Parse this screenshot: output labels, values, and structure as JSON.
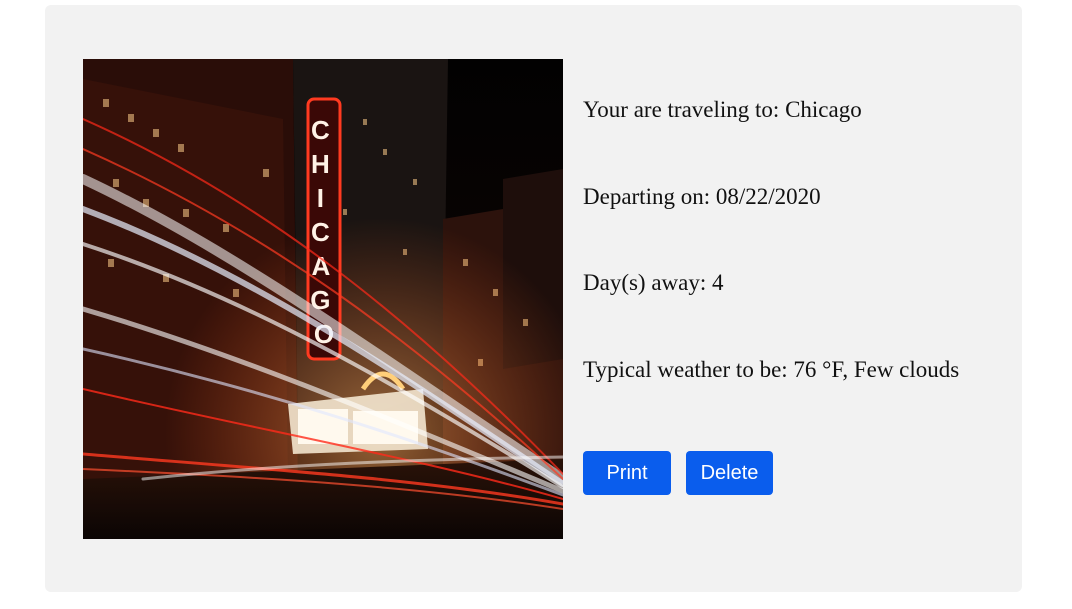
{
  "trip": {
    "destination_label": "Your are traveling to: ",
    "destination": "Chicago",
    "departure_label": "Departing on: ",
    "departure_date": "08/22/2020",
    "days_away_label": "Day(s) away: ",
    "days_away": "4",
    "weather_label": "Typical weather to be: ",
    "weather": "76 °F, Few clouds"
  },
  "image": {
    "subject": "chicago-theatre-night-photo",
    "sign_text": "CHICAGO"
  },
  "actions": {
    "print_label": "Print",
    "delete_label": "Delete"
  },
  "colors": {
    "card_background": "#f2f2f2",
    "button_background": "#0a5ded",
    "button_text": "#ffffff"
  }
}
